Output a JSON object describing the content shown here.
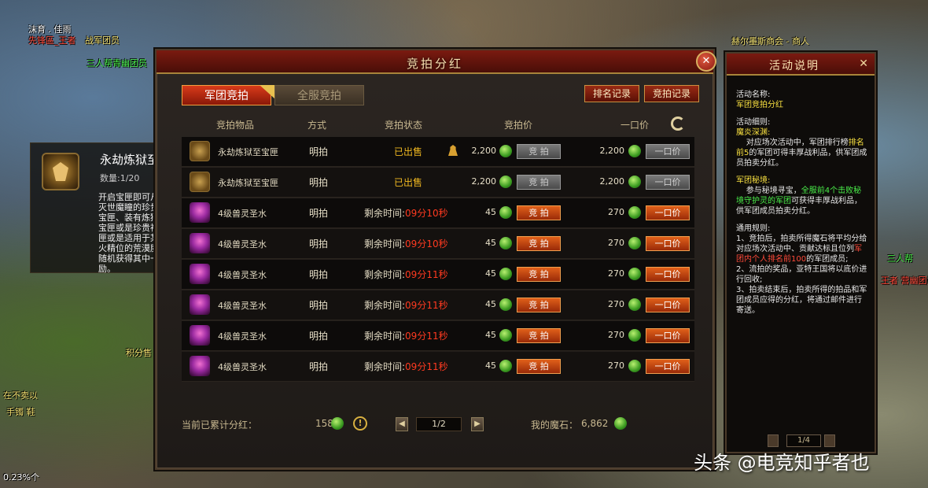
{
  "world": {
    "texts": [
      {
        "text": "沫育 . 佳雨",
        "cls": "wt-white",
        "l": 0
      },
      {
        "text": "先锋區_王者",
        "cls": "wt-red",
        "l": 1
      },
      {
        "text": "战军团员",
        "cls": "wt-yellow",
        "l": 2
      },
      {
        "text": "三人帮青幽团员",
        "cls": "wt-green",
        "l": 3
      },
      {
        "text": "赫尔墨斯商会 - 商人",
        "cls": "wt-yellow",
        "l": 4
      },
      {
        "text": "积分售",
        "cls": "wt-yellow",
        "l": 5
      },
      {
        "text": "在不卖以",
        "cls": "wt-yellow",
        "l": 6
      },
      {
        "text": "手镯 鞋",
        "cls": "wt-yellow",
        "l": 7
      },
      {
        "text": "0.23%个",
        "cls": "wt-white",
        "l": 8
      },
      {
        "text": "三人帮",
        "cls": "wt-green",
        "l": 9
      },
      {
        "text": "王者 营幽团员",
        "cls": "wt-red",
        "l": 10
      }
    ]
  },
  "item_tooltip": {
    "name": "永劫炼狱至宝匣",
    "quantity": "数量:1/20",
    "description": "开启宝匣即可从装有灭世魔瞳的珍贵神火宝匣、装有炼狱神火宝匣或是珍贵神火宝匣或是适用于某一神火精位的荒漠魔焰中随机获得其中一种奖励。"
  },
  "main": {
    "title": "竞拍分红",
    "tabs": {
      "active": "军团竞拍",
      "inactive": "全服竞拍"
    },
    "buttons": {
      "rank_record": "排名记录",
      "bid_record": "竞拍记录"
    },
    "columns": {
      "item": "竞拍物品",
      "method": "方式",
      "status": "竞拍状态",
      "bid_price": "竞拍价",
      "buyout_price": "一口价"
    },
    "rows": [
      {
        "thumb": "box",
        "name": "永劫炼狱至宝匣",
        "method": "明拍",
        "status_type": "sold",
        "status": "已出售",
        "has_bidder": true,
        "bid": "2,200",
        "bid_btn": "竞 拍",
        "buyout": "2,200",
        "buyout_btn": "一口价",
        "enabled": false
      },
      {
        "thumb": "box",
        "name": "永劫炼狱至宝匣",
        "method": "明拍",
        "status_type": "sold",
        "status": "已出售",
        "has_bidder": false,
        "bid": "2,200",
        "bid_btn": "竞 拍",
        "buyout": "2,200",
        "buyout_btn": "一口价",
        "enabled": false
      },
      {
        "thumb": "potion",
        "name": "4级兽灵圣水",
        "method": "明拍",
        "status_type": "timer",
        "status_label": "剩余时间:",
        "time": "09分10秒",
        "bid": "45",
        "bid_btn": "竞 拍",
        "buyout": "270",
        "buyout_btn": "一口价",
        "enabled": true
      },
      {
        "thumb": "potion",
        "name": "4级兽灵圣水",
        "method": "明拍",
        "status_type": "timer",
        "status_label": "剩余时间:",
        "time": "09分10秒",
        "bid": "45",
        "bid_btn": "竞 拍",
        "buyout": "270",
        "buyout_btn": "一口价",
        "enabled": true
      },
      {
        "thumb": "potion",
        "name": "4级兽灵圣水",
        "method": "明拍",
        "status_type": "timer",
        "status_label": "剩余时间:",
        "time": "09分11秒",
        "bid": "45",
        "bid_btn": "竞 拍",
        "buyout": "270",
        "buyout_btn": "一口价",
        "enabled": true
      },
      {
        "thumb": "potion",
        "name": "4级兽灵圣水",
        "method": "明拍",
        "status_type": "timer",
        "status_label": "剩余时间:",
        "time": "09分11秒",
        "bid": "45",
        "bid_btn": "竞 拍",
        "buyout": "270",
        "buyout_btn": "一口价",
        "enabled": true
      },
      {
        "thumb": "potion",
        "name": "4级兽灵圣水",
        "method": "明拍",
        "status_type": "timer",
        "status_label": "剩余时间:",
        "time": "09分11秒",
        "bid": "45",
        "bid_btn": "竞 拍",
        "buyout": "270",
        "buyout_btn": "一口价",
        "enabled": true
      },
      {
        "thumb": "potion",
        "name": "4级兽灵圣水",
        "method": "明拍",
        "status_type": "timer",
        "status_label": "剩余时间:",
        "time": "09分11秒",
        "bid": "45",
        "bid_btn": "竞 拍",
        "buyout": "270",
        "buyout_btn": "一口价",
        "enabled": true
      }
    ],
    "footer": {
      "dividend_label": "当前已累计分红：",
      "dividend_value": "158",
      "page": "1/2",
      "magic_stone_label": "我的魔石：",
      "magic_stone_value": "6,862"
    }
  },
  "side": {
    "title": "活动说明",
    "name_label": "活动名称:",
    "name_value": "军团竞拍分红",
    "detail_label": "活动细则:",
    "sec1_title": "魔炎深渊:",
    "sec1_a": "对应场次活动中，军团排行榜",
    "sec1_hl": "排名前5",
    "sec1_b": "的军团可得丰厚战利品，供军团成员拍卖分红。",
    "sec2_title": "军团秘境:",
    "sec2_a": "参与秘境寻宝，",
    "sec2_hl1": "全服前4个击败秘境守护灵的军团",
    "sec2_b": "可获得丰厚战利品，供军团成员拍卖分红。",
    "rules_title": "通用规则:",
    "rule1_a": "1、竞拍后，拍卖所得魔石将平均分给对应场次活动中、贡献达标且位列",
    "rule1_hl": "军团内个人排名前100",
    "rule1_b": "的军团成员;",
    "rule2": "2、流拍的奖品，亚特王国将以底价进行回收;",
    "rule3": "3、拍卖结束后，拍卖所得的拍品和军团成员应得的分红，将通过邮件进行寄送。",
    "page": "1/4"
  },
  "watermark": "头条 @电竞知乎者也",
  "colors": {
    "panel_red": "#7a1a10",
    "accent_gold": "#a8843a",
    "button_orange": "#e0601a",
    "sold_yellow": "#f0b820",
    "timer_red": "#ff3a20",
    "gem_green": "#3a9a20"
  }
}
